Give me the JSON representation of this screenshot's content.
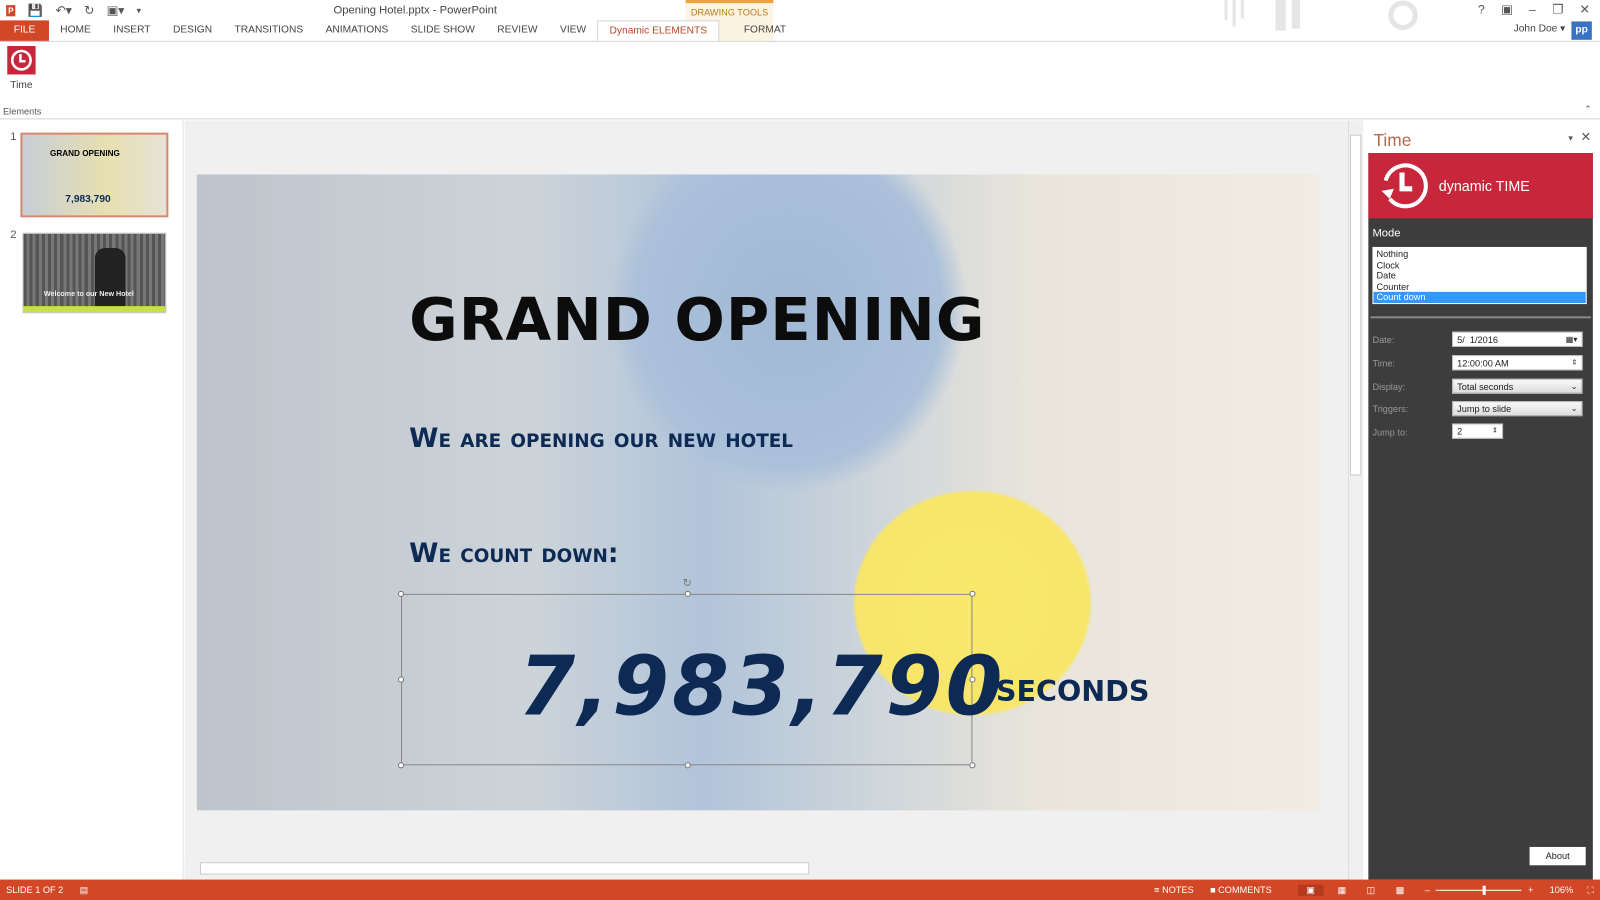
{
  "window": {
    "title": "Opening Hotel.pptx - PowerPoint",
    "contextual_group": "DRAWING TOOLS",
    "user": "John Doe",
    "account_badge": "pp"
  },
  "tabs": [
    {
      "label": "FILE"
    },
    {
      "label": "HOME"
    },
    {
      "label": "INSERT"
    },
    {
      "label": "DESIGN"
    },
    {
      "label": "TRANSITIONS"
    },
    {
      "label": "ANIMATIONS"
    },
    {
      "label": "SLIDE SHOW"
    },
    {
      "label": "REVIEW"
    },
    {
      "label": "VIEW"
    },
    {
      "label": "Dynamic ELEMENTS",
      "active": true
    },
    {
      "label": "FORMAT"
    }
  ],
  "ribbon": {
    "time_button": "Time",
    "group_label": "Elements"
  },
  "thumbnails": [
    {
      "number": "1",
      "selected": true,
      "title": "GRAND OPENING",
      "value": "7,983,790"
    },
    {
      "number": "2",
      "caption": "Welcome to our New Hotel"
    }
  ],
  "slide": {
    "title": "GRAND OPENING",
    "subtitle": "We are opening our new hotel",
    "countdown_label": "We count down:",
    "countdown_value": "7,983,790",
    "unit": "SECONDS"
  },
  "pane": {
    "title": "Time",
    "brand": "dynamic TIME",
    "mode_label": "Mode",
    "modes": [
      "Nothing",
      "Clock",
      "Date",
      "Counter",
      "Count down"
    ],
    "selected_mode": "Count down",
    "fields": {
      "date_label": "Date:",
      "date": "5/  1/2016",
      "time_label": "Time:",
      "time": "12:00:00 AM",
      "display_label": "Display:",
      "display": "Total seconds",
      "triggers_label": "Triggers:",
      "triggers": "Jump to slide",
      "jump_label": "Jump to:",
      "jump": "2"
    },
    "about": "About"
  },
  "status": {
    "slide": "SLIDE 1 OF 2",
    "notes": "NOTES",
    "comments": "COMMENTS",
    "zoom": "106%"
  },
  "colors": {
    "accent": "#d24726",
    "brand": "#c8273b",
    "pane_bg": "#3d3d3d",
    "selection": "#3399ff"
  }
}
